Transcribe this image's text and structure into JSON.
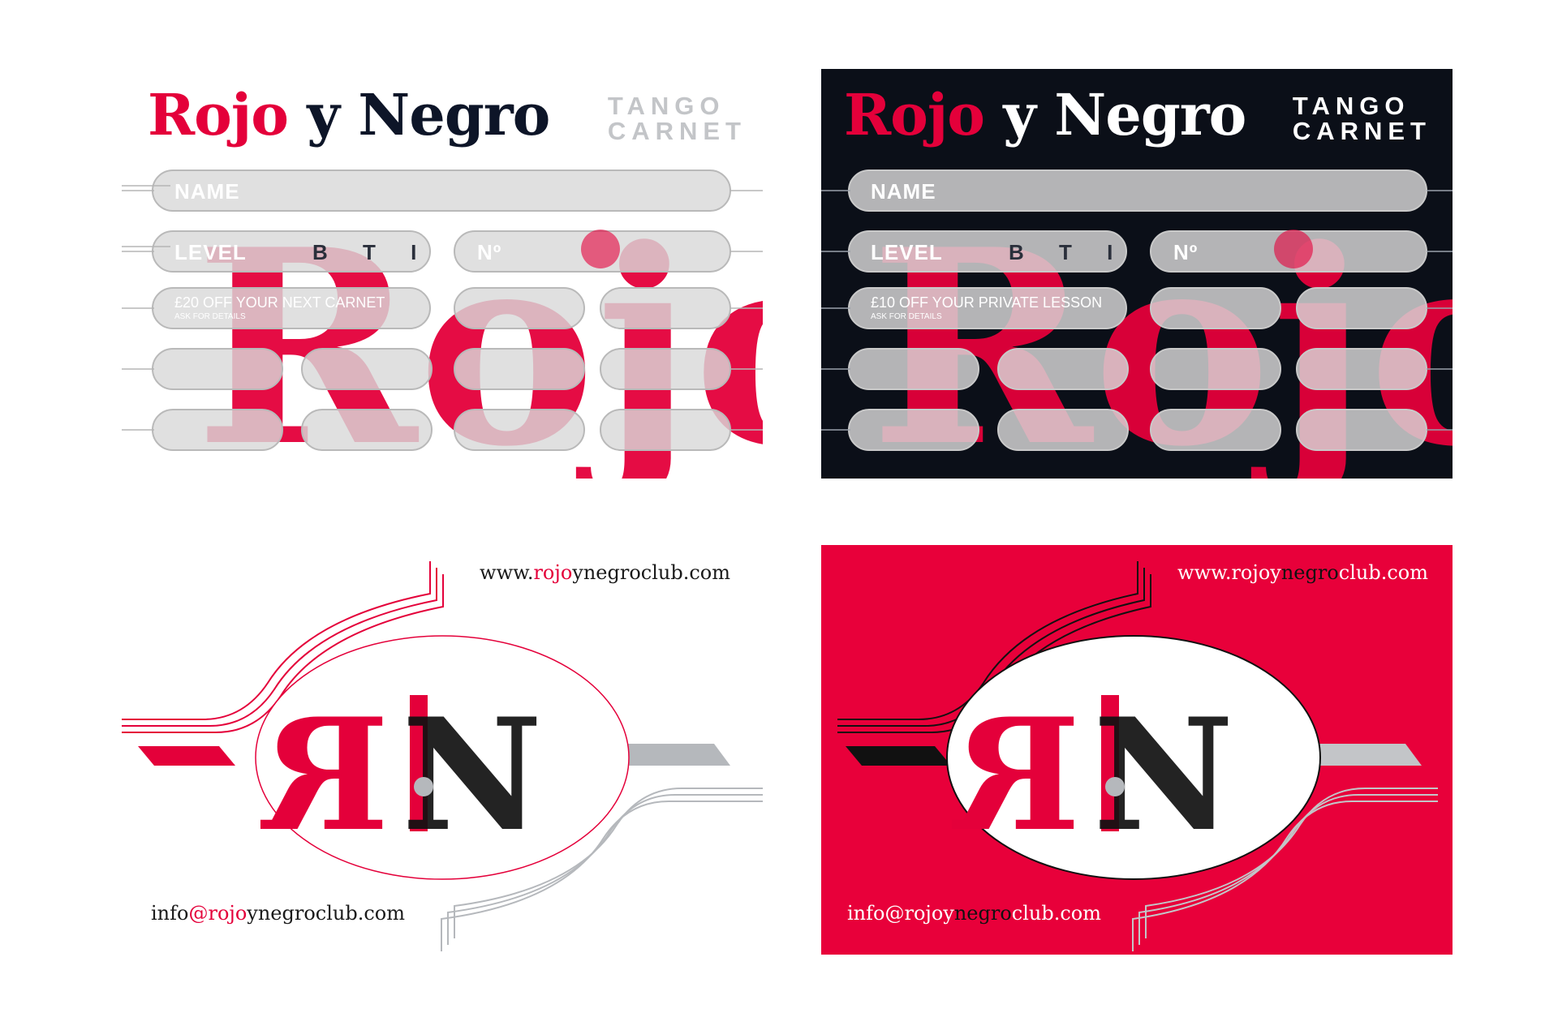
{
  "brand": {
    "rojo": "Rojo",
    "y_negro": " y Negro",
    "tango": "TANGO",
    "carnet": "CARNET"
  },
  "carnet_light": {
    "name_label": "NAME",
    "level_label": "LEVEL",
    "levels": "B T I",
    "number_label": "Nº",
    "offer": "£20 OFF YOUR NEXT CARNET",
    "ask": "ASK FOR DETAILS"
  },
  "carnet_dark": {
    "name_label": "NAME",
    "level_label": "LEVEL",
    "levels": "B T I",
    "number_label": "Nº",
    "offer": "£10 OFF YOUR PRIVATE LESSON",
    "ask": "ASK FOR DETAILS"
  },
  "contact": {
    "web_prefix": "www.",
    "web_rojo": "rojo",
    "web_y": "y",
    "web_negro": "negro",
    "web_suffix": "club.com",
    "mail_prefix": "info",
    "mail_at": "@",
    "mail_rojo": "rojo",
    "mail_y": "y",
    "mail_negro": "negro",
    "mail_suffix": "club.com"
  },
  "colors": {
    "red": "#e4003a",
    "navy": "#0b0f18",
    "grey": "#c3c5c8",
    "pill": "#d8d8d8"
  }
}
